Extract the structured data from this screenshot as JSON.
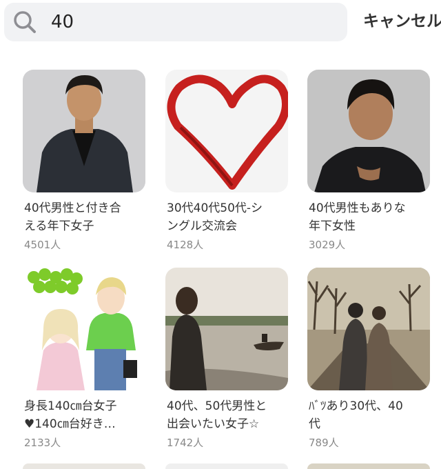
{
  "search": {
    "query": "40",
    "cancel_label": "キャンセル"
  },
  "results": [
    {
      "title_line1": "40代男性と付き合",
      "title_line2": "える年下女子",
      "members": "4501人",
      "image": "man-portrait-photo"
    },
    {
      "title_line1": "30代40代50代-シ",
      "title_line2": "ングル交流会",
      "members": "4128人",
      "image": "red-heart-icon"
    },
    {
      "title_line1": "40代男性もありな",
      "title_line2": "年下女性",
      "members": "3029人",
      "image": "man-portrait-photo"
    },
    {
      "title_line1": "身長140㎝台女子",
      "title_line2": "♥140㎝台好き…",
      "members": "2133人",
      "image": "manga-couple-illustration"
    },
    {
      "title_line1": "40代、50代男性と",
      "title_line2": "出会いたい女子☆",
      "members": "1742人",
      "image": "lake-woman-photo"
    },
    {
      "title_line1": "ﾊﾞﾂあり30代、40",
      "title_line2": "代",
      "members": "789人",
      "image": "couple-walking-photo"
    }
  ]
}
